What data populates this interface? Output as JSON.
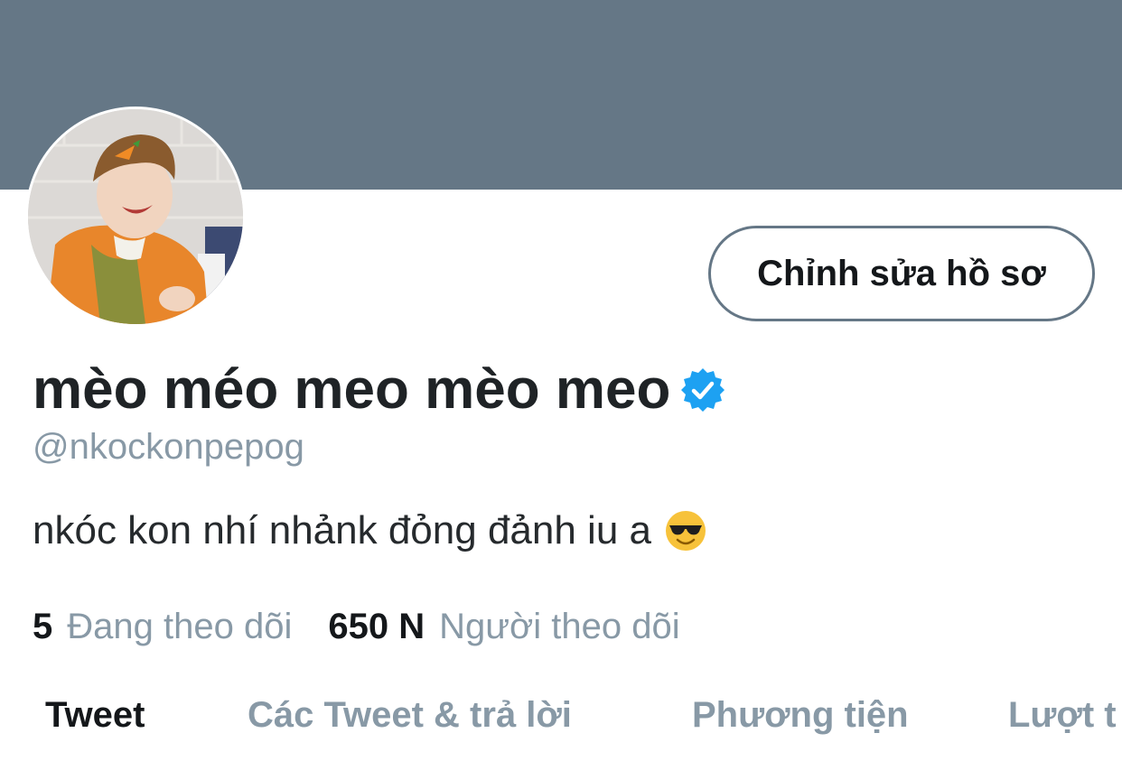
{
  "profile": {
    "display_name": "mèo méo meo mèo meo",
    "handle": "@nkockonpepog",
    "bio": "nkóc kon nhí nhảnk đỏng đảnh iu a",
    "bio_emoji": "smiling-face-with-sunglasses",
    "verified": true
  },
  "actions": {
    "edit_profile_label": "Chỉnh sửa hồ sơ"
  },
  "stats": {
    "following_count": "5",
    "following_label": "Đang theo dõi",
    "followers_count": "650 N",
    "followers_label": "Người theo dõi"
  },
  "tabs": [
    {
      "label": "Tweet",
      "active": true
    },
    {
      "label": "Các Tweet & trả lời",
      "active": false
    },
    {
      "label": "Phương tiện",
      "active": false
    },
    {
      "label": "Lượt t",
      "active": false
    }
  ],
  "colors": {
    "banner": "#657786",
    "verified_badge": "#1da1f2",
    "secondary_text": "#8899a6"
  }
}
